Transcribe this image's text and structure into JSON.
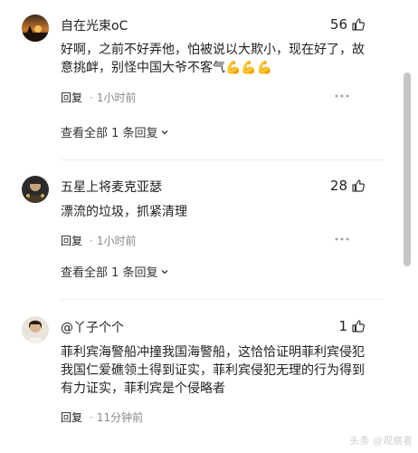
{
  "comments": [
    {
      "username": "自在光束oC",
      "likes": "56",
      "text": "好啊，之前不好弄他，怕被说以大欺小，现在好了，故意挑衅，别怪中国大爷不客气",
      "emoji": "💪💪💪",
      "reply_label": "回复",
      "time": "1小时前",
      "view_replies": "查看全部 1 条回复"
    },
    {
      "username": "五星上将麦克亚瑟",
      "likes": "28",
      "text": "漂流的垃圾，抓紧清理",
      "reply_label": "回复",
      "time": "1小时前",
      "view_replies": "查看全部 1 条回复"
    },
    {
      "username": "@丫子个个",
      "likes": "1",
      "text": "菲利宾海警船冲撞我国海警船，这恰恰证明菲利宾侵犯我国仁爱礁领土得到证实，菲利宾侵犯无理的行为得到有力证实，菲利宾是个侵略者",
      "reply_label": "回复",
      "time": "11分钟前"
    }
  ],
  "icons": {
    "like": "thumbs-up-icon",
    "more": "more-dots-icon",
    "expand": "chevron-down-icon"
  },
  "watermark": "头条 @观察者"
}
